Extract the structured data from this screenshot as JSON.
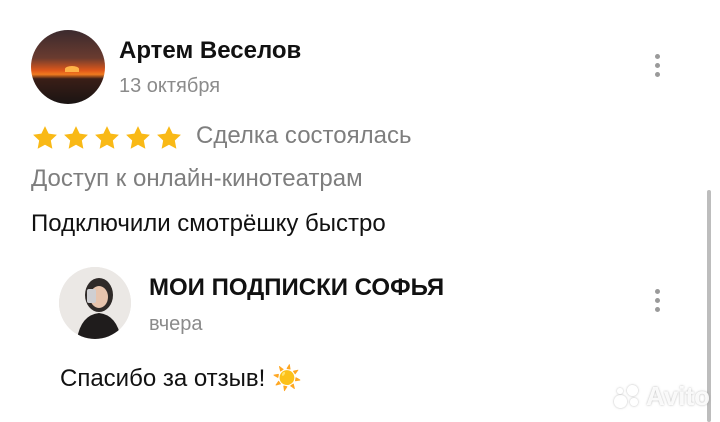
{
  "review": {
    "author_name": "Артем Веселов",
    "date": "13 октября",
    "rating": 5,
    "deal_status": "Сделка состоялась",
    "category": "Доступ к онлайн-кинотеатрам",
    "text": "Подключили смотрёшку быстро"
  },
  "reply": {
    "author_name": "МОИ ПОДПИСКИ СОФЬЯ",
    "date": "вчера",
    "text": "Спасибо за отзыв! ☀️"
  },
  "watermark": {
    "text": "Avito"
  },
  "icons": {
    "star": "star-icon",
    "menu": "more-vertical-icon",
    "brand": "avito-logo"
  },
  "colors": {
    "star": "#f9b916",
    "secondary_text": "#7e7e7e",
    "primary_text": "#111111",
    "kebab": "#9a9a9a"
  }
}
